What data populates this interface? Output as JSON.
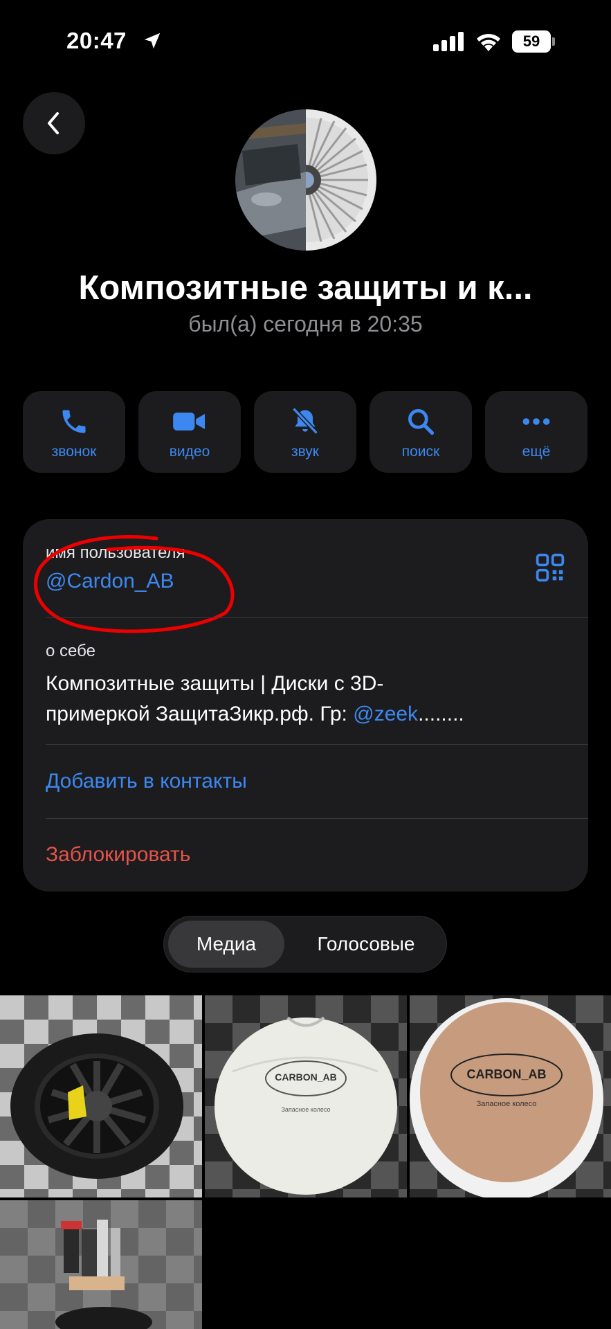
{
  "status_bar": {
    "time": "20:47",
    "battery": "59"
  },
  "profile": {
    "name": "Композитные защиты и к...",
    "last_seen": "был(а) сегодня в 20:35"
  },
  "actions": [
    {
      "label": "звонок",
      "icon": "phone-icon"
    },
    {
      "label": "видео",
      "icon": "video-camera-icon"
    },
    {
      "label": "звук",
      "icon": "bell-muted-icon"
    },
    {
      "label": "поиск",
      "icon": "search-icon"
    },
    {
      "label": "ещё",
      "icon": "more-dots-icon"
    }
  ],
  "info": {
    "username_label": "имя пользователя",
    "username": "@Cardon_AB",
    "about_label": "о себе",
    "about_line1": "Композитные защиты | Диски с 3D-",
    "about_line2_prefix": "примеркой ЗащитаЗикр.рф. Гр: ",
    "about_mention": "@zeek",
    "about_suffix": "........",
    "add_contact": "Добавить в контакты",
    "block": "Заблокировать"
  },
  "tabs": {
    "media": "Медиа",
    "voice": "Голосовые"
  },
  "media": [
    {
      "caption": "",
      "brand": ""
    },
    {
      "caption": "Запасное колесо",
      "brand": "CARBON_AB"
    },
    {
      "caption": "Запасное колесо",
      "brand": "CARBON_AB"
    },
    {
      "caption": "",
      "brand": ""
    }
  ],
  "colors": {
    "accent": "#3d88f0",
    "destructive": "#e5534b",
    "card": "#1c1c1e",
    "background": "#000000"
  }
}
